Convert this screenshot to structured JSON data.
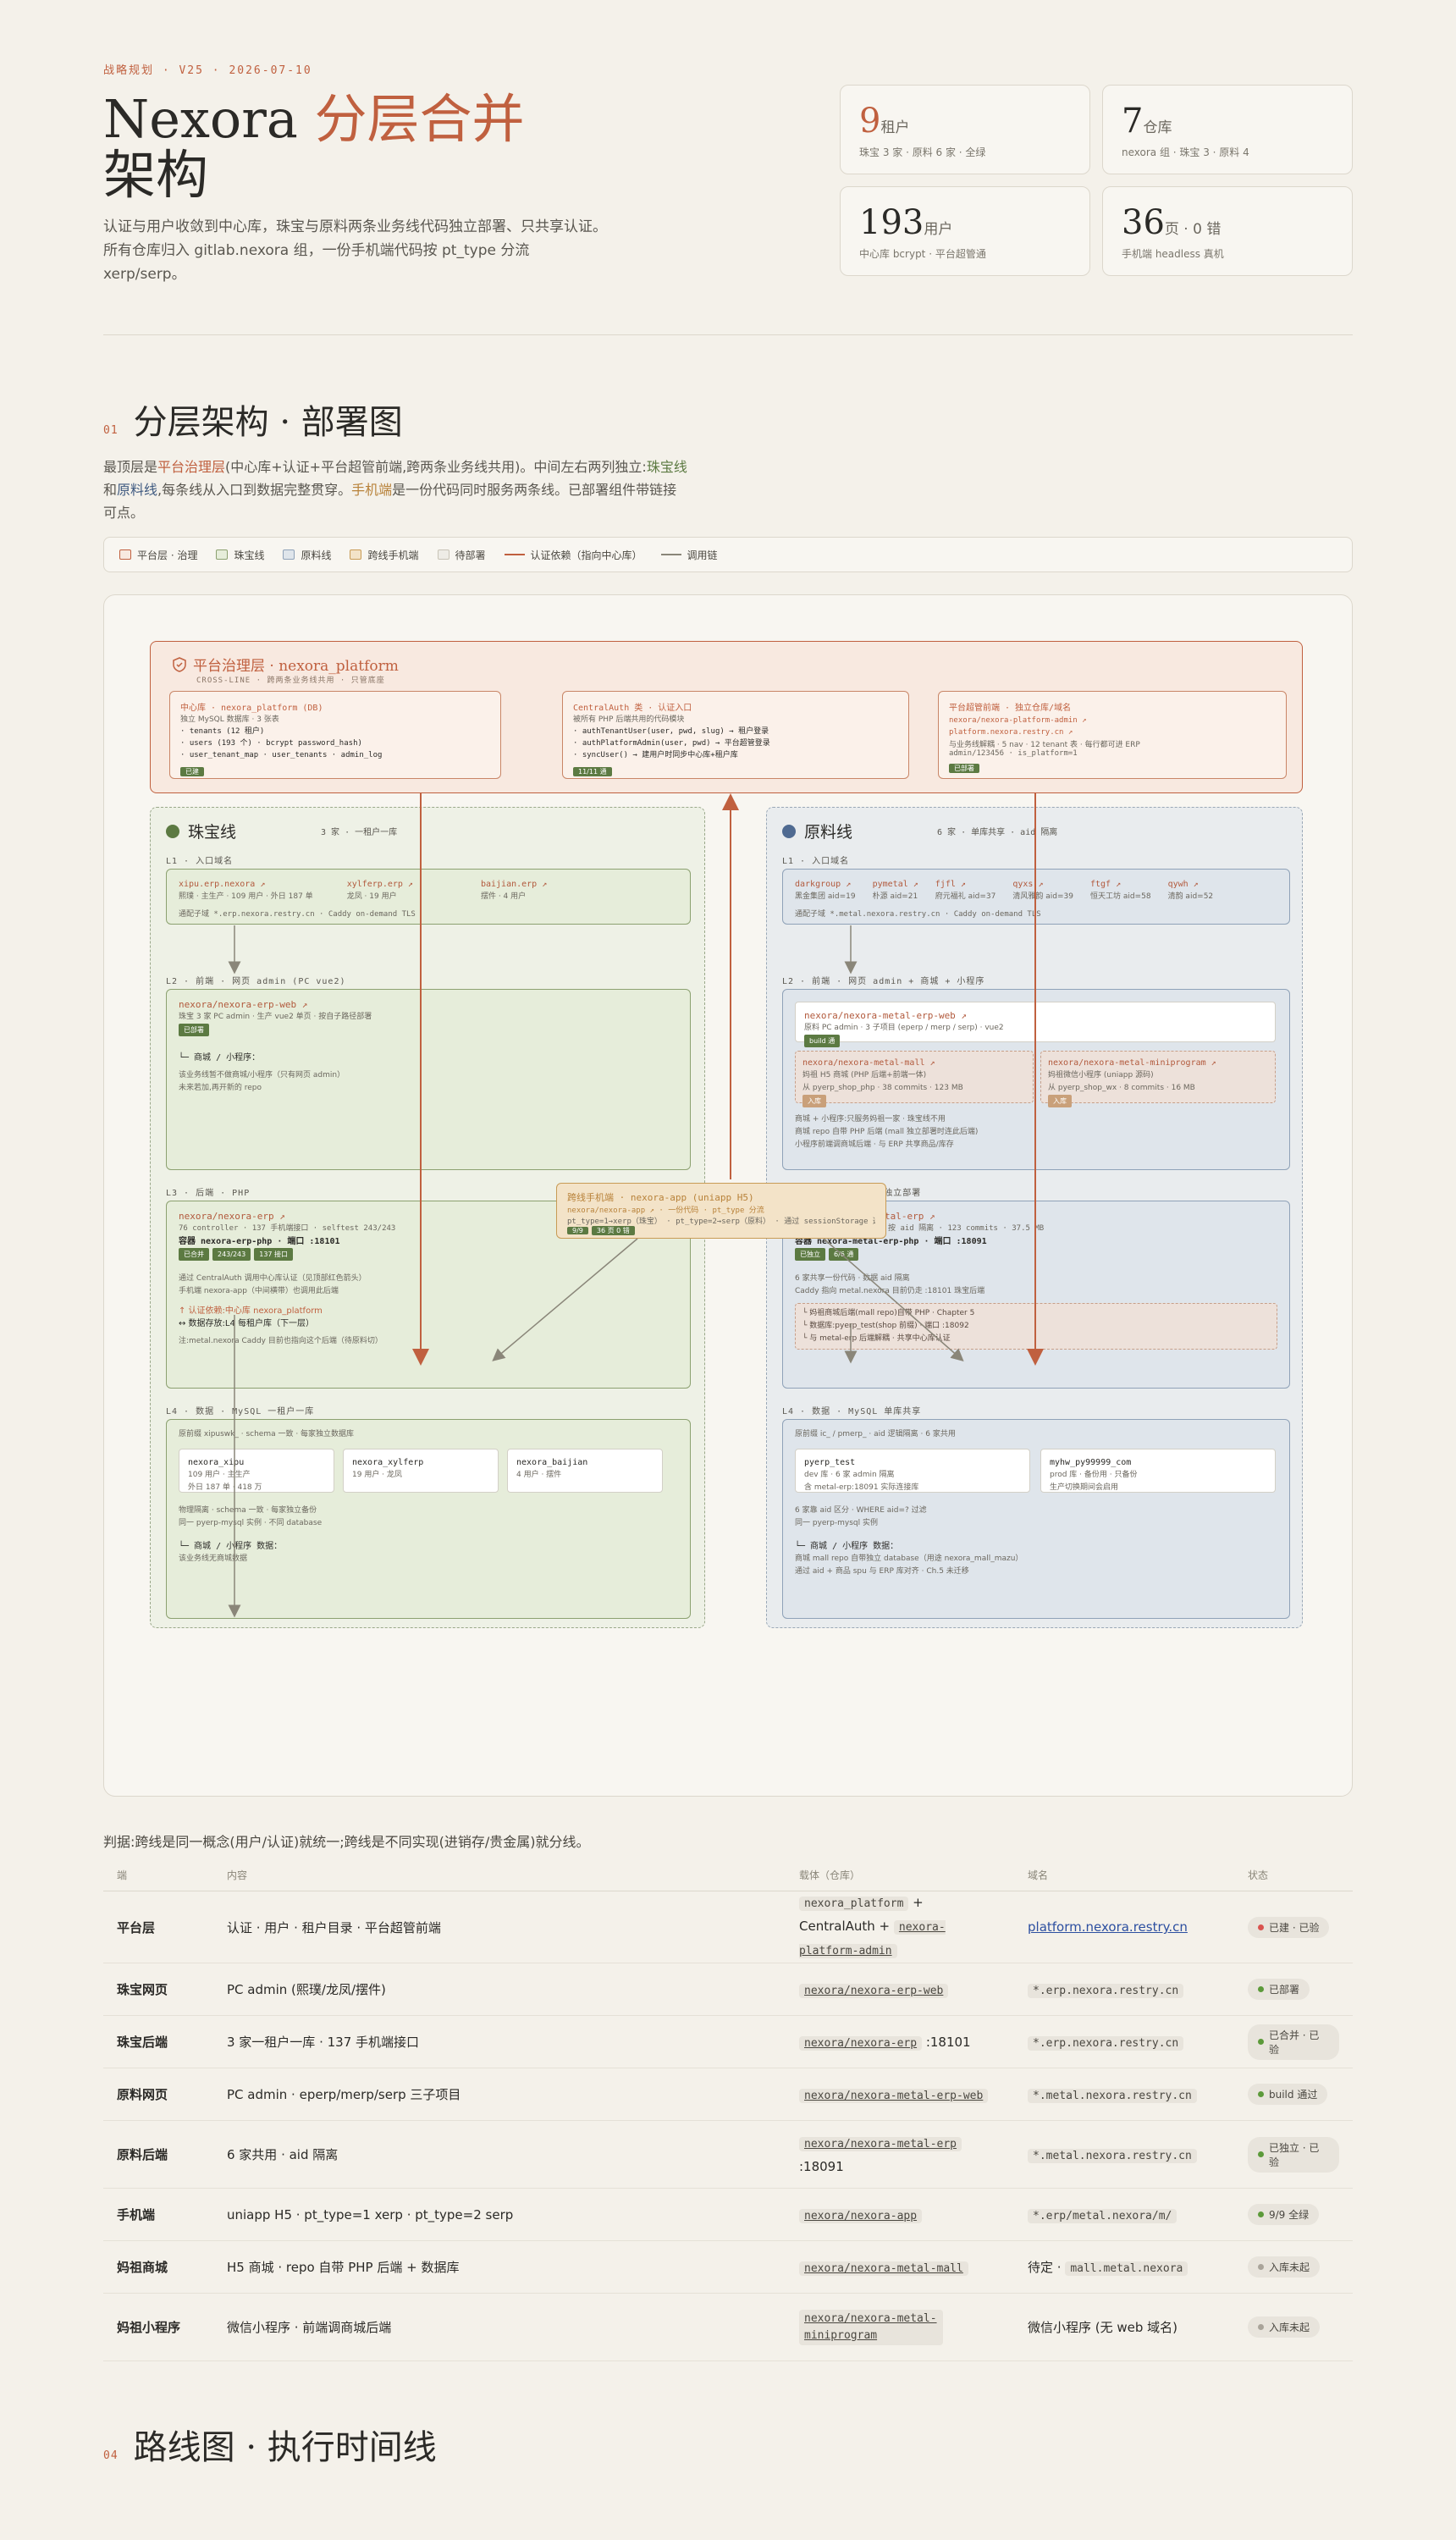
{
  "header": {
    "eyebrow": "战略规划 · V25 · 2026-07-10",
    "title_main": "Nexora ",
    "title_accent": "分层合并",
    "title_tail": "架构",
    "lede": "认证与用户收敛到中心库，珠宝与原料两条业务线代码独立部署、只共享认证。所有仓库归入 gitlab.nexora 组，一份手机端代码按 pt_type 分流 xerp/serp。"
  },
  "stats": [
    {
      "num": "9",
      "unit": "租户",
      "sub": "珠宝 3 家 · 原料 6 家 · 全绿",
      "accent": true
    },
    {
      "num": "7",
      "unit": "仓库",
      "sub": "nexora 组 · 珠宝 3 · 原料 4",
      "accent": false
    },
    {
      "num": "193",
      "unit": "用户",
      "sub": "中心库 bcrypt · 平台超管通",
      "accent": false
    },
    {
      "num": "36",
      "unit": "页 · 0 错",
      "sub": "手机端 headless 真机",
      "accent": false
    }
  ],
  "section1": {
    "no": "01",
    "title": "分层架构 · 部署图",
    "desc_a": "最顶层是",
    "desc_plat": "平台治理层",
    "desc_b": "(中心库+认证+平台超管前端,跨两条业务线共用)。中间左右两列独立:",
    "desc_jew": "珠宝线",
    "desc_c": "和",
    "desc_raw": "原料线",
    "desc_d": ",每条线从入口到数据完整贯穿。",
    "desc_mob": "手机端",
    "desc_e": "是一份代码同时服务两条线。已部署组件带链接可点。"
  },
  "legend": [
    {
      "label": "平台层 · 治理",
      "kind": "swatch",
      "fill": "#f8e9e0",
      "stroke": "#c0603f"
    },
    {
      "label": "珠宝线",
      "kind": "swatch",
      "fill": "#e6edda",
      "stroke": "#8ca170"
    },
    {
      "label": "原料线",
      "kind": "swatch",
      "fill": "#dfe5eb",
      "stroke": "#8fa2b8"
    },
    {
      "label": "跨线手机端",
      "kind": "swatch",
      "fill": "#f3e3c8",
      "stroke": "#c89b55"
    },
    {
      "label": "待部署",
      "kind": "swatch",
      "fill": "#eeece6",
      "stroke": "#c8c3b6"
    },
    {
      "label": "认证依赖（指向中心库）",
      "kind": "line",
      "fill": "#c0603f",
      "stroke": "#c0603f"
    },
    {
      "label": "调用链",
      "kind": "line",
      "fill": "#8a8679",
      "stroke": "#8a8679"
    }
  ],
  "diagram": {
    "platform": {
      "title": "平台治理层 · nexora_platform",
      "subtitle": "CROSS-LINE · 跨两条业务线共用 · 只管底座",
      "db": {
        "cap": "中心库 · nexora_platform (DB)",
        "sub": "独立 MySQL 数据库 · 3 张表",
        "lines": [
          "· tenants (12 租户)",
          "· users (193 个) · bcrypt password_hash)",
          "· user_tenant_map · user_tenants · admin_log"
        ],
        "tag": "已建"
      },
      "auth": {
        "cap": "CentralAuth 类 · 认证入口",
        "sub": "被所有 PHP 后端共用的代码模块",
        "lines": [
          "· authTenantUser(user, pwd, slug) → 租户登录",
          "· authPlatformAdmin(user, pwd) → 平台超管登录",
          "· syncUser() → 建用户时同步中心库+租户库"
        ],
        "tag": "11/11 通"
      },
      "admin": {
        "cap": "平台超管前端 · 独立仓库/域名",
        "lines": [
          "nexora/nexora-platform-admin ↗",
          "platform.nexora.restry.cn ↗",
          "与业务线解耦 · 5 nav · 12 tenant 表 · 每行都可进 ERP",
          "admin/123456 · is_platform=1"
        ],
        "tag": "已部署"
      }
    },
    "jewelry": {
      "title": "珠宝线",
      "note": "3 家 · 一租户一库",
      "l1": {
        "label": "L1 · 入口域名",
        "sites": [
          {
            "name": "xipu.erp.nexora ↗",
            "desc": "熙璞 · 主生产 · 109 用户 · 外日 187 单"
          },
          {
            "name": "xylferp.erp ↗",
            "desc": "龙凤 · 19 用户"
          },
          {
            "name": "baijian.erp ↗",
            "desc": "摆件 · 4 用户"
          }
        ],
        "foot": "通配子域 *.erp.nexora.restry.cn · Caddy on-demand TLS"
      },
      "l2": {
        "label": "L2 · 前端 · 网页 admin (PC vue2)",
        "repo": "nexora/nexora-erp-web ↗",
        "desc": "珠宝 3 家 PC admin · 生产 vue2 单页 · 按自子路径部署",
        "tag": "已部署",
        "mall_head": "└─ 商城 / 小程序：",
        "mall_lines": [
          "该业务线暂不做商城/小程序（只有网页 admin）",
          "未来若加,再开新的 repo"
        ]
      },
      "l3": {
        "label": "L3 · 后端 · PHP",
        "repo": "nexora/nexora-erp ↗",
        "desc": "76 controller · 137 手机端接口 · selftest 243/243",
        "container": "容器 nexora-erp-php · 端口 :18101",
        "tags": [
          "已合并",
          "243/243",
          "137 接口"
        ],
        "lines": [
          "通过 CentralAuth 调用中心库认证（见顶部红色箭头）",
          "手机端 nexora-app（中间横带）也调用此后端"
        ],
        "auth_lines": [
          "↑ 认证依赖:中心库 nexora_platform",
          "↔ 数据存放:L4 每租户库（下一层）"
        ],
        "foot": "注:metal.nexora Caddy 目前也指向这个后端（待原料切）"
      },
      "l4": {
        "label": "L4 · 数据 · MySQL 一租户一库",
        "sub": "原前缀 xipuswk_ · schema 一致 · 每家独立数据库",
        "dbs": [
          {
            "name": "nexora_xipu",
            "l1": "109 用户 · 主生产",
            "l2": "外日 187 单 · 418 万"
          },
          {
            "name": "nexora_xylferp",
            "l1": "19 用户 · 龙凤",
            "l2": ""
          },
          {
            "name": "nexora_baijian",
            "l1": "4 用户 · 摆件",
            "l2": ""
          }
        ],
        "lines": [
          "物理隔离 · schema 一致 · 每家独立备份",
          "同一 pyerp-mysql 实例 · 不同 database"
        ],
        "mall_head": "└─ 商城 / 小程序 数据：",
        "mall_line": "该业务线无商城数据"
      }
    },
    "raw": {
      "title": "原料线",
      "note": "6 家 · 单库共享 · aid 隔离",
      "l1": {
        "label": "L1 · 入口域名",
        "sites": [
          {
            "name": "darkgroup ↗",
            "desc": "黑金集团 aid=19"
          },
          {
            "name": "pymetal ↗",
            "desc": "朴源 aid=21"
          },
          {
            "name": "fjfl ↗",
            "desc": "府元福礼 aid=37"
          },
          {
            "name": "qyxs ↗",
            "desc": "清风雅韵 aid=39"
          },
          {
            "name": "ftgf ↗",
            "desc": "恒天工坊 aid=58"
          },
          {
            "name": "qywh ↗",
            "desc": "清韵 aid=52"
          }
        ],
        "foot": "通配子域 *.metal.nexora.restry.cn · Caddy on-demand TLS"
      },
      "l2": {
        "label": "L2 · 前端 · 网页 admin + 商城 + 小程序",
        "repo": "nexora/nexora-metal-erp-web ↗",
        "desc": "原料 PC admin · 3 子项目 (eperp / merp / serp) · vue2",
        "tag": "build 通",
        "mall": {
          "repo": "nexora/nexora-metal-mall ↗",
          "l1": "妈祖 H5 商城 (PHP 后端+前端一体)",
          "l2": "从 pyerp_shop_php · 38 commits · 123 MB",
          "tag": "入库"
        },
        "mini": {
          "repo": "nexora/nexora-metal-miniprogram ↗",
          "l1": "妈祖微信小程序 (uniapp 源码)",
          "l2": "从 pyerp_shop_wx · 8 commits · 16 MB",
          "tag": "入库"
        },
        "lines": [
          "商城 + 小程序:只服务妈祖一家 · 珠宝线不用",
          "商城 repo 自带 PHP 后端 (mall 独立部署时连此后端)",
          "小程序前端调商城后端 · 与 ERP 共享商品/库存"
        ]
      },
      "l3": {
        "label": "L3 · 后端 · PHP · 独立部署",
        "repo": "nexora/nexora-metal-erp ↗",
        "desc": "原料 PHP · 6 家共用 · 按 aid 隔离 · 123 commits · 37.5 MB",
        "container": "容器 nexora-metal-erp-php · 端口 :18091",
        "tags": [
          "已独立",
          "6/6 通"
        ],
        "lines": [
          "6 家共享一份代码 · 数据 aid 隔离",
          "Caddy 指向 metal.nexora 目前仍走 :18101 珠宝后端"
        ],
        "box_lines": [
          "└ 妈祖商城后端(mall repo)自带 PHP · Chapter 5",
          "└ 数据库:pyerp_test(shop 前缀) · 端口 :18092",
          "└ 与 metal-erp 后端解耦 · 共享中心库认证"
        ]
      },
      "l4": {
        "label": "L4 · 数据 · MySQL 单库共享",
        "sub": "原前缀 ic_ / pmerp_ · aid 逻辑隔离 · 6 家共用",
        "dbs": [
          {
            "name": "pyerp_test",
            "l1": "dev 库 · 6 家 admin 隔离",
            "l2": "含 metal-erp:18091 实际连接库"
          },
          {
            "name": "myhw_py99999_com",
            "l1": "prod 库 · 备份用 · 只备份",
            "l2": "生产切换期间会启用"
          }
        ],
        "lines": [
          "6 家靠 aid 区分 · WHERE aid=? 过滤",
          "同一 pyerp-mysql 实例"
        ],
        "mall_head": "└─ 商城 / 小程序 数据：",
        "mall_lines": [
          "商城 mall repo 自带独立 database（用途 nexora_mall_mazu）",
          "通过 aid + 商品 spu 与 ERP 库对齐 · Ch.5 未迁移"
        ]
      }
    },
    "mobile": {
      "cap": "跨线手机端 · nexora-app (uniapp H5)",
      "line": "nexora/nexora-app ↗ · 一份代码 · pt_type 分流",
      "line2": "pt_type=1→xerp（珠宝） · pt_type=2→serp（原料） · 通过 sessionStorage 选中",
      "tags": [
        "9/9",
        "36 页 0 错"
      ]
    }
  },
  "judgement": "判据:跨线是同一概念(用户/认证)就统一;跨线是不同实现(进销存/贵金属)就分线。",
  "table": {
    "headers": [
      "端",
      "内容",
      "载体（仓库）",
      "域名",
      "状态"
    ],
    "rows": [
      {
        "end": "平台层",
        "content": "认证 · 用户 · 租户目录 · 平台超管前端",
        "repo_a": "nexora_platform",
        "repo_mid": " + CentralAuth + ",
        "repo_b": "nexora-platform-admin",
        "domain": "platform.nexora.restry.cn",
        "domain_kind": "link",
        "status": "已建 · 已验",
        "status_color": "#d9534f"
      },
      {
        "end": "珠宝网页",
        "content": "PC admin (熙璞/龙凤/摆件)",
        "repo_a": "nexora/nexora-erp-web",
        "repo_mid": "",
        "repo_b": "",
        "domain": "*.erp.nexora.restry.cn",
        "domain_kind": "code",
        "status": "已部署",
        "status_color": "#5c9a3a"
      },
      {
        "end": "珠宝后端",
        "content": "3 家一租户一库 · 137 手机端接口",
        "repo_a": "nexora/nexora-erp",
        "repo_mid": " :18101",
        "repo_b": "",
        "domain": "*.erp.nexora.restry.cn",
        "domain_kind": "code",
        "status": "已合并 · 已验",
        "status_color": "#5c9a3a"
      },
      {
        "end": "原料网页",
        "content": "PC admin · eperp/merp/serp 三子项目",
        "repo_a": "nexora/nexora-metal-erp-web",
        "repo_mid": "",
        "repo_b": "",
        "domain": "*.metal.nexora.restry.cn",
        "domain_kind": "code",
        "status": "build 通过",
        "status_color": "#5c9a3a"
      },
      {
        "end": "原料后端",
        "content": "6 家共用 · aid 隔离",
        "repo_a": "nexora/nexora-metal-erp",
        "repo_mid": " :18091",
        "repo_b": "",
        "domain": "*.metal.nexora.restry.cn",
        "domain_kind": "code",
        "status": "已独立 · 已验",
        "status_color": "#5c9a3a"
      },
      {
        "end": "手机端",
        "content": "uniapp H5 · pt_type=1 xerp · pt_type=2 serp",
        "repo_a": "nexora/nexora-app",
        "repo_mid": "",
        "repo_b": "",
        "domain": "*.erp/metal.nexora/m/",
        "domain_kind": "code",
        "status": "9/9 全绿",
        "status_color": "#5c9a3a"
      },
      {
        "end": "妈祖商城",
        "content": "H5 商城 · repo 自带 PHP 后端 + 数据库",
        "repo_a": "nexora/nexora-metal-mall",
        "repo_mid": "",
        "repo_b": "",
        "domain": "mall.metal.nexora",
        "domain_prefix": "待定 · ",
        "domain_kind": "code",
        "status": "入库未起",
        "status_color": "#a9a49a"
      },
      {
        "end": "妈祖小程序",
        "content": "微信小程序 · 前端调商城后端",
        "repo_a": "nexora/nexora-metal-miniprogram",
        "repo_mid": "",
        "repo_b": "",
        "domain": "微信小程序 (无 web 域名)",
        "domain_kind": "text",
        "status": "入库未起",
        "status_color": "#a9a49a"
      }
    ]
  },
  "section4": {
    "no": "04",
    "title": "路线图 · 执行时间线"
  }
}
